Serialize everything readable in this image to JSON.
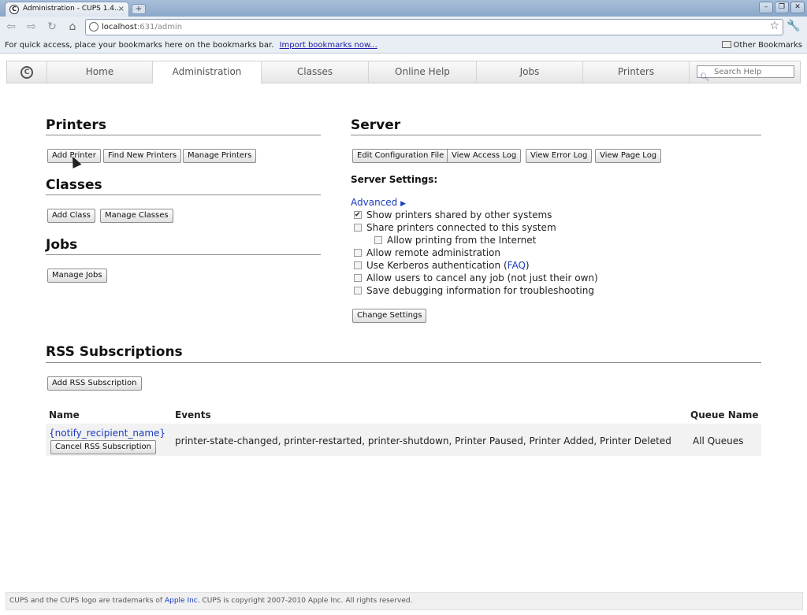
{
  "browser": {
    "tab_title": "Administration - CUPS 1.4...",
    "tab_close": "×",
    "new_tab": "+",
    "url_host": "localhost",
    "url_path": ":631/admin",
    "bookmarks_prompt": "For quick access, place your bookmarks here on the bookmarks bar.",
    "import_link": "Import bookmarks now...",
    "other_bookmarks": "Other Bookmarks"
  },
  "nav": {
    "tabs": [
      "Home",
      "Administration",
      "Classes",
      "Online Help",
      "Jobs",
      "Printers"
    ],
    "active": "Administration",
    "search_placeholder": "Search Help"
  },
  "printers": {
    "title": "Printers",
    "buttons": [
      "Add Printer",
      "Find New Printers",
      "Manage Printers"
    ]
  },
  "classes": {
    "title": "Classes",
    "buttons": [
      "Add Class",
      "Manage Classes"
    ]
  },
  "jobs": {
    "title": "Jobs",
    "buttons": [
      "Manage Jobs"
    ]
  },
  "server": {
    "title": "Server",
    "buttons": [
      "Edit Configuration File",
      "View Access Log",
      "View Error Log",
      "View Page Log"
    ],
    "settings_label": "Server Settings:",
    "advanced": "Advanced",
    "options": [
      {
        "label": "Show printers shared by other systems",
        "checked": true
      },
      {
        "label": "Share printers connected to this system",
        "checked": false
      },
      {
        "label": "Allow printing from the Internet",
        "checked": false
      },
      {
        "label": "Allow remote administration",
        "checked": false
      },
      {
        "label": "Use Kerberos authentication (",
        "checked": false
      },
      {
        "label": "Allow users to cancel any job (not just their own)",
        "checked": false
      },
      {
        "label": "Save debugging information for troubleshooting",
        "checked": false
      }
    ],
    "faq": "FAQ",
    "faq_close": ")",
    "change_settings": "Change Settings"
  },
  "rss": {
    "title": "RSS Subscriptions",
    "add_button": "Add RSS Subscription",
    "columns": [
      "Name",
      "Events",
      "Queue Name"
    ],
    "rows": [
      {
        "name": "{notify_recipient_name}",
        "cancel_button": "Cancel RSS Subscription",
        "events": "printer-state-changed, printer-restarted, printer-shutdown, Printer Paused, Printer Added, Printer Deleted",
        "queue": "All Queues"
      }
    ]
  },
  "footer": {
    "text_before": "CUPS and the CUPS logo are trademarks of",
    "apple_link": "Apple Inc.",
    "text_after": "CUPS is copyright 2007-2010 Apple Inc. All rights reserved."
  }
}
